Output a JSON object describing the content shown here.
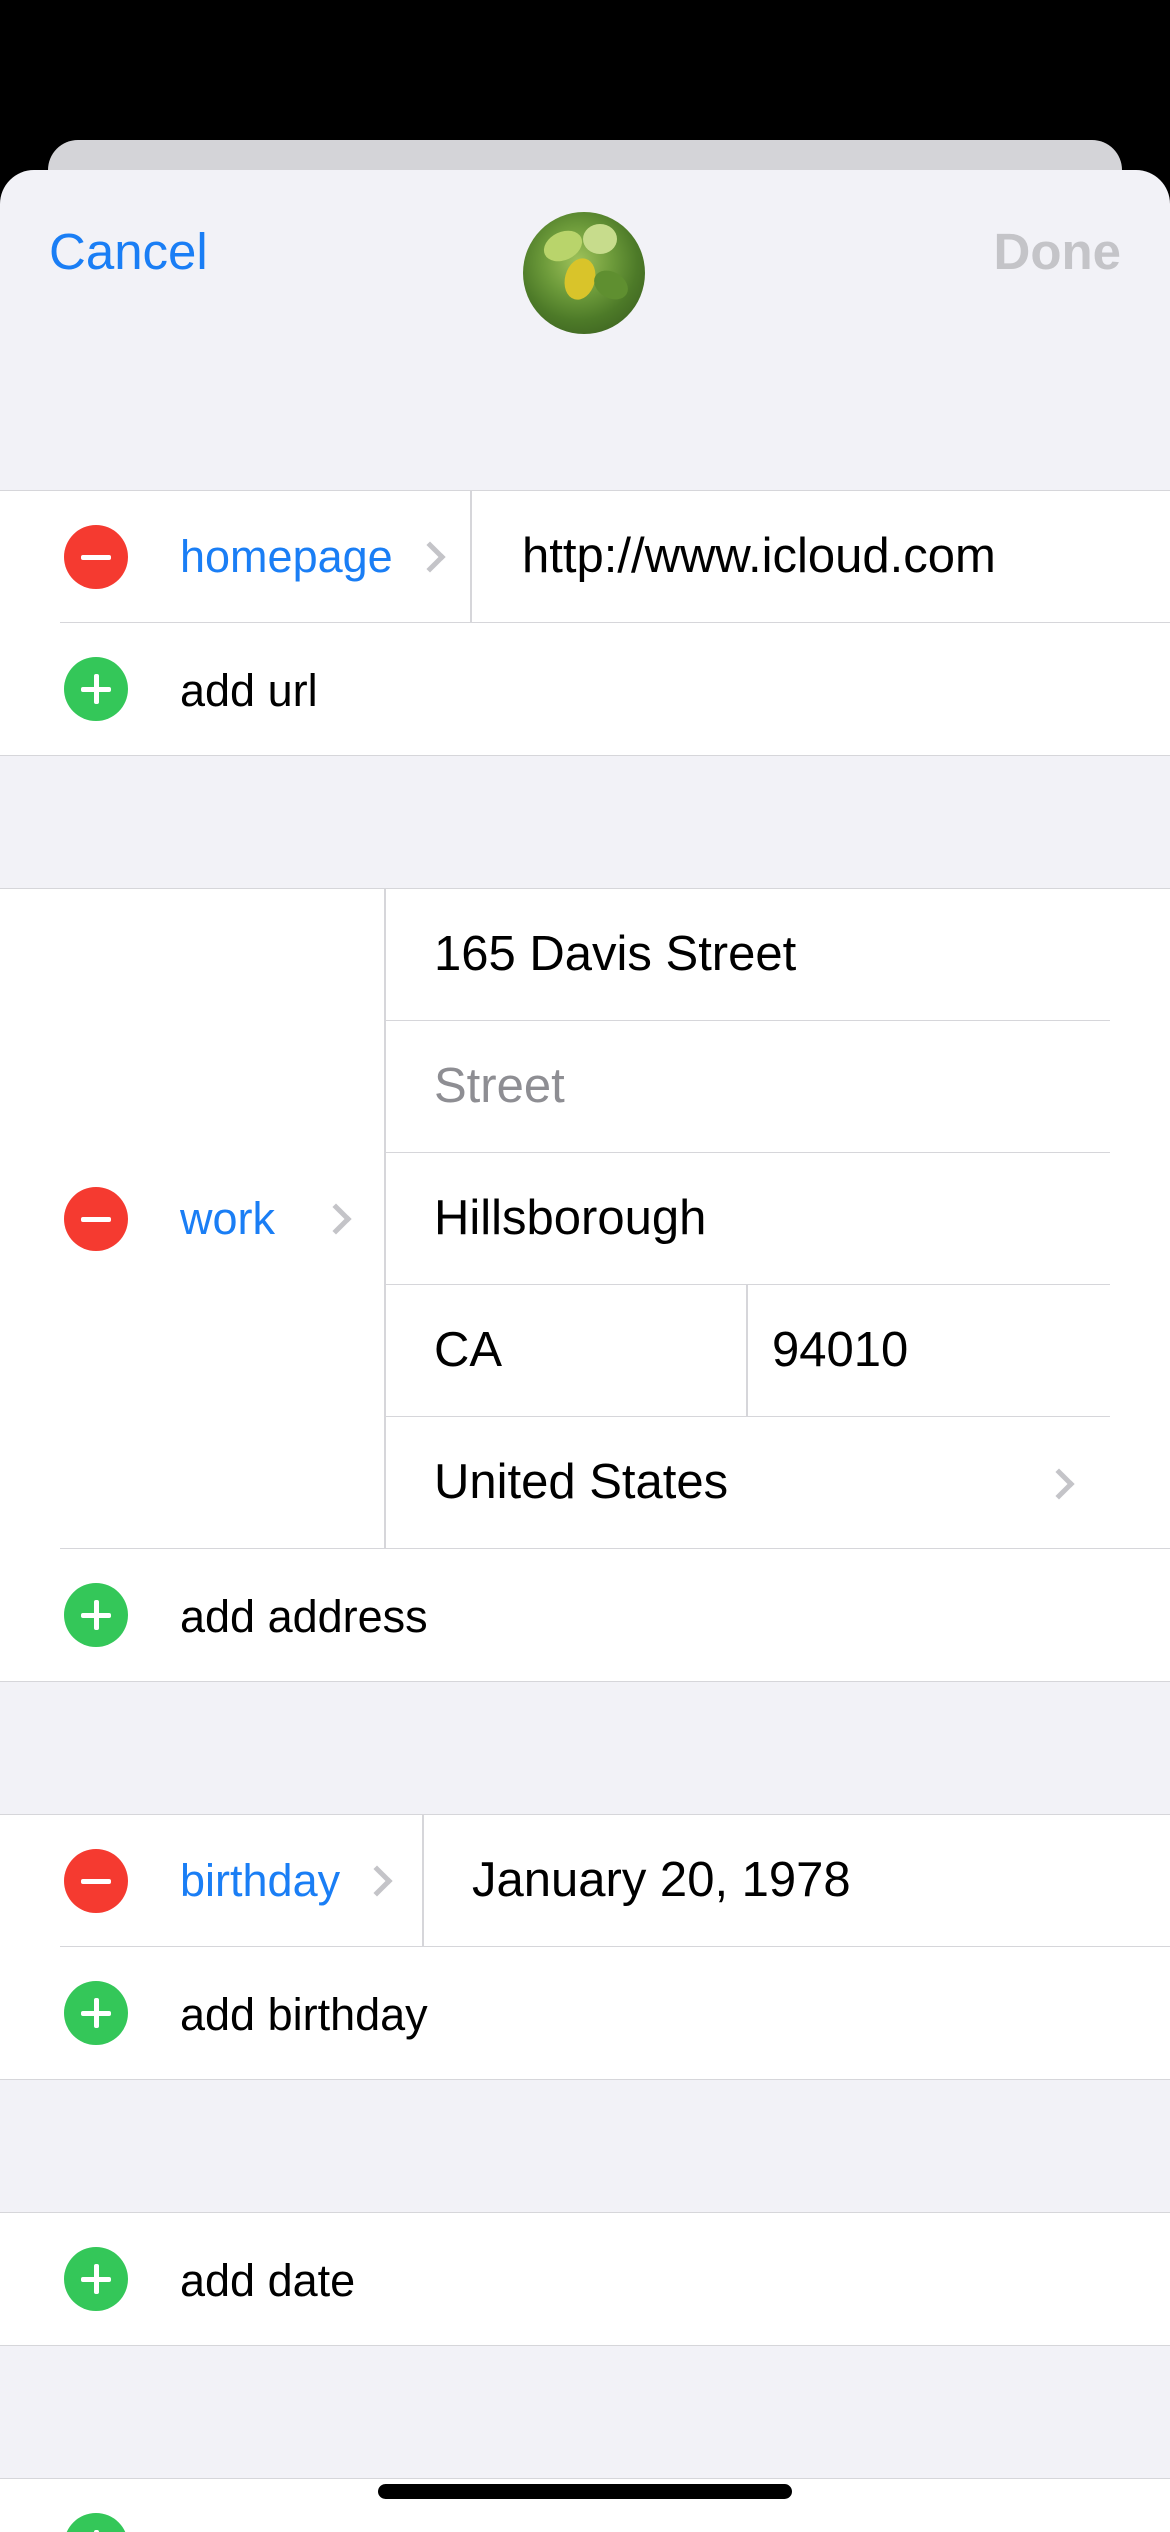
{
  "nav": {
    "cancel": "Cancel",
    "done": "Done"
  },
  "url": {
    "label": "homepage",
    "value": "http://www.icloud.com",
    "add_label": "add url"
  },
  "address": {
    "label": "work",
    "street1": "165 Davis Street",
    "street2_placeholder": "Street",
    "city": "Hillsborough",
    "state": "CA",
    "zip": "94010",
    "country": "United States",
    "add_label": "add address"
  },
  "birthday": {
    "label": "birthday",
    "value": "January 20, 1978",
    "add_label": "add birthday"
  },
  "date": {
    "add_label": "add date"
  },
  "colors": {
    "accent": "#1a7ef5",
    "remove": "#f53a30",
    "add": "#34c759",
    "background": "#f2f2f7"
  }
}
